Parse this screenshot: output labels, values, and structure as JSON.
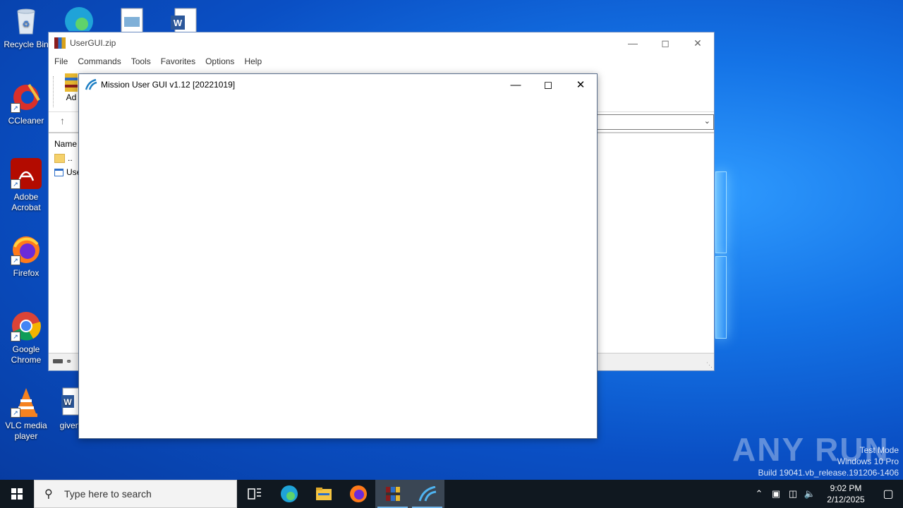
{
  "desktop": {
    "icons": [
      {
        "label": "Recycle Bin",
        "icon": "recycle-bin-icon"
      },
      {
        "label": "CCleaner",
        "icon": "ccleaner-icon"
      },
      {
        "label": "Adobe Acrobat",
        "icon": "adobe-acrobat-icon"
      },
      {
        "label": "Firefox",
        "icon": "firefox-icon"
      },
      {
        "label": "Google Chrome",
        "icon": "chrome-icon"
      },
      {
        "label": "VLC media player",
        "icon": "vlc-icon"
      },
      {
        "label": "givenr",
        "icon": "word-document-icon"
      }
    ]
  },
  "winrar": {
    "title": "UserGUI.zip",
    "menu": [
      "File",
      "Commands",
      "Tools",
      "Favorites",
      "Options",
      "Help"
    ],
    "toolbar_partial_label": "Ad",
    "list_header": "Name",
    "rows": [
      "..",
      "Use"
    ]
  },
  "mission": {
    "title": "Mission User GUI v1.12 [20221019]"
  },
  "watermark": {
    "brand": "ANY RUN",
    "line1": "Test Mode",
    "line2": "Windows 10 Pro",
    "line3": "Build 19041.vb_release.191206-1406"
  },
  "taskbar": {
    "search_placeholder": "Type here to search",
    "apps": [
      "task-view-icon",
      "edge-icon",
      "file-explorer-icon",
      "firefox-icon",
      "winrar-icon",
      "mission-gui-icon"
    ],
    "time": "9:02 PM",
    "date": "2/12/2025"
  },
  "colors": {
    "desktop": "#0a4fc4",
    "taskbar": "#101820",
    "accent": "#76b9ed"
  }
}
